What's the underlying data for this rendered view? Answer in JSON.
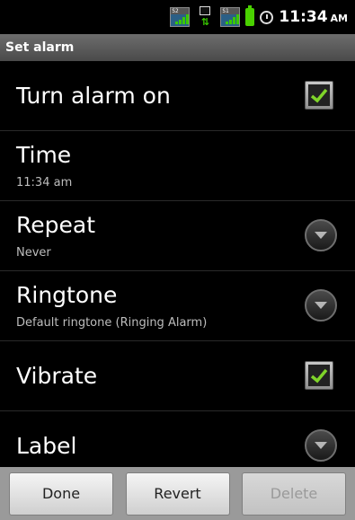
{
  "status_bar": {
    "sim1_label": "S2",
    "sim2_label": "S1",
    "time": "11:34",
    "ampm": "AM"
  },
  "header": {
    "title": "Set alarm"
  },
  "settings": [
    {
      "id": "turn-alarm-on",
      "title": "Turn alarm on",
      "subtitle": "",
      "control": "checkbox",
      "checked": true
    },
    {
      "id": "time",
      "title": "Time",
      "subtitle": "11:34 am",
      "control": "none"
    },
    {
      "id": "repeat",
      "title": "Repeat",
      "subtitle": "Never",
      "control": "disclosure"
    },
    {
      "id": "ringtone",
      "title": "Ringtone",
      "subtitle": "Default ringtone (Ringing Alarm)",
      "control": "disclosure"
    },
    {
      "id": "vibrate",
      "title": "Vibrate",
      "subtitle": "",
      "control": "checkbox",
      "checked": true
    },
    {
      "id": "label",
      "title": "Label",
      "subtitle": "",
      "control": "disclosure"
    }
  ],
  "buttons": {
    "done": "Done",
    "revert": "Revert",
    "delete": "Delete"
  },
  "colors": {
    "check": "#7fd42a",
    "background": "#000000",
    "title_bar": "#5a5a5a",
    "button_bar": "#9a9a9a"
  }
}
